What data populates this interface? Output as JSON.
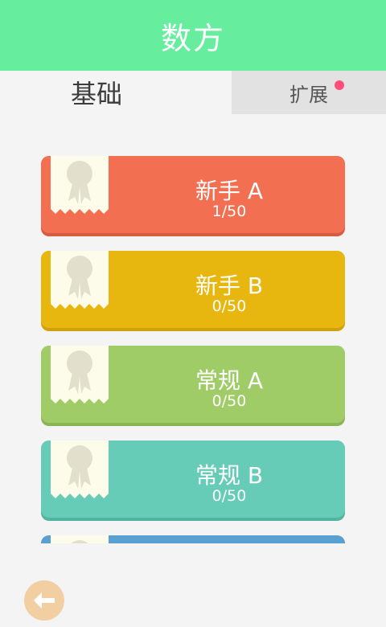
{
  "header": {
    "title": "数方"
  },
  "tabs": [
    {
      "label": "基础",
      "active": true
    },
    {
      "label": "扩展",
      "active": false,
      "has_notification": true
    }
  ],
  "levels": [
    {
      "title": "新手 A",
      "progress": "1/50",
      "color": "#f26f52",
      "shadow": "#d95a3f"
    },
    {
      "title": "新手 B",
      "progress": "0/50",
      "color": "#e8b70f",
      "shadow": "#cfa10a"
    },
    {
      "title": "常规 A",
      "progress": "0/50",
      "color": "#a0cc68",
      "shadow": "#8bb554"
    },
    {
      "title": "常规 B",
      "progress": "0/50",
      "color": "#66ccb8",
      "shadow": "#52b3a0"
    },
    {
      "title": "",
      "progress": "",
      "color": "#5aa0d0",
      "shadow": "#4888b8"
    }
  ],
  "icons": {
    "badge": "ribbon-badge-icon",
    "back": "arrow-left-icon"
  },
  "colors": {
    "header_bg": "#66ee9e",
    "back_button_bg": "#f1cfa2"
  }
}
